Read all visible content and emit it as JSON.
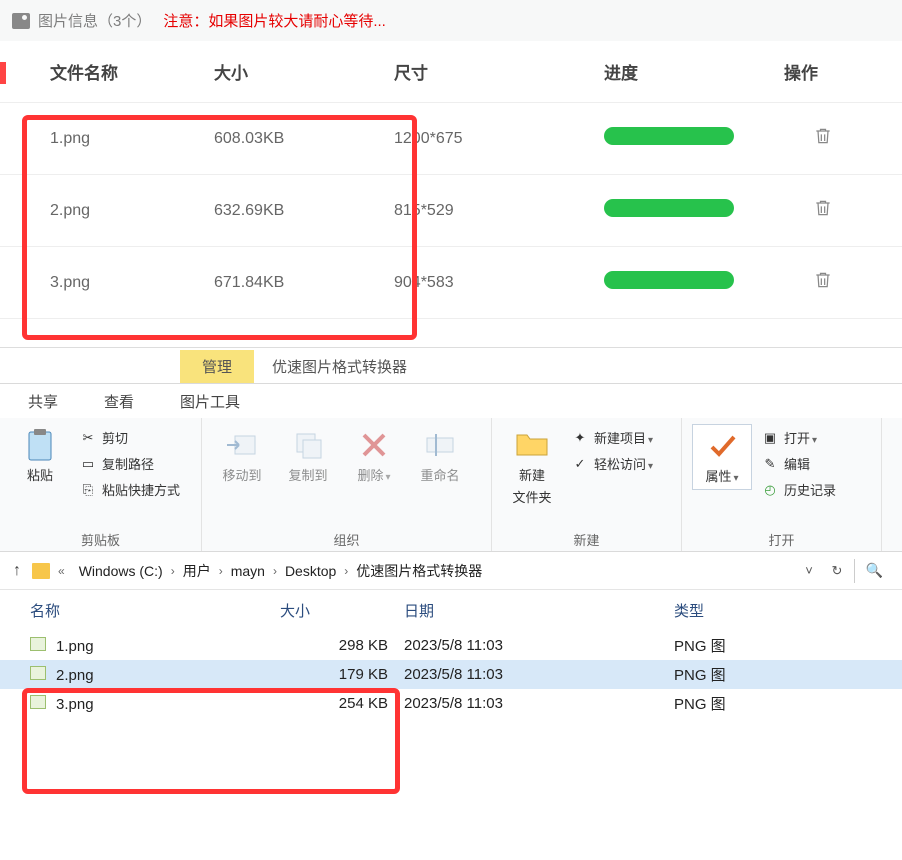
{
  "panel": {
    "header_title": "图片信息（3个）",
    "header_warning": "注意：如果图片较大请耐心等待...",
    "columns": {
      "name": "文件名称",
      "size": "大小",
      "dim": "尺寸",
      "progress": "进度",
      "op": "操作"
    },
    "rows": [
      {
        "name": "1.png",
        "size": "608.03KB",
        "dim": "1200*675"
      },
      {
        "name": "2.png",
        "size": "632.69KB",
        "dim": "815*529"
      },
      {
        "name": "3.png",
        "size": "671.84KB",
        "dim": "904*583"
      }
    ]
  },
  "explorer": {
    "top_tabs": {
      "manage": "管理",
      "title": "优速图片格式转换器"
    },
    "sub_tabs": {
      "share": "共享",
      "view": "查看",
      "pictools": "图片工具"
    },
    "ribbon": {
      "clipboard": {
        "paste": "粘贴",
        "cut": "剪切",
        "copypath": "复制路径",
        "pasteshortcut": "粘贴快捷方式",
        "label": "剪贴板"
      },
      "organize": {
        "moveto": "移动到",
        "copyto": "复制到",
        "delete": "删除",
        "rename": "重命名",
        "label": "组织"
      },
      "new": {
        "newfolder": "新建",
        "newfolder2": "文件夹",
        "newitem": "新建项目",
        "easyaccess": "轻松访问",
        "label": "新建"
      },
      "open": {
        "properties": "属性",
        "open": "打开",
        "edit": "编辑",
        "history": "历史记录",
        "label": "打开"
      }
    },
    "breadcrumbs": [
      "Windows (C:)",
      "用户",
      "mayn",
      "Desktop",
      "优速图片格式转换器"
    ],
    "list_header": {
      "name": "名称",
      "size": "大小",
      "date": "日期",
      "type": "类型"
    },
    "files": [
      {
        "name": "1.png",
        "size": "298 KB",
        "date": "2023/5/8 11:03",
        "type": "PNG 图"
      },
      {
        "name": "2.png",
        "size": "179 KB",
        "date": "2023/5/8 11:03",
        "type": "PNG 图"
      },
      {
        "name": "3.png",
        "size": "254 KB",
        "date": "2023/5/8 11:03",
        "type": "PNG 图"
      }
    ]
  }
}
